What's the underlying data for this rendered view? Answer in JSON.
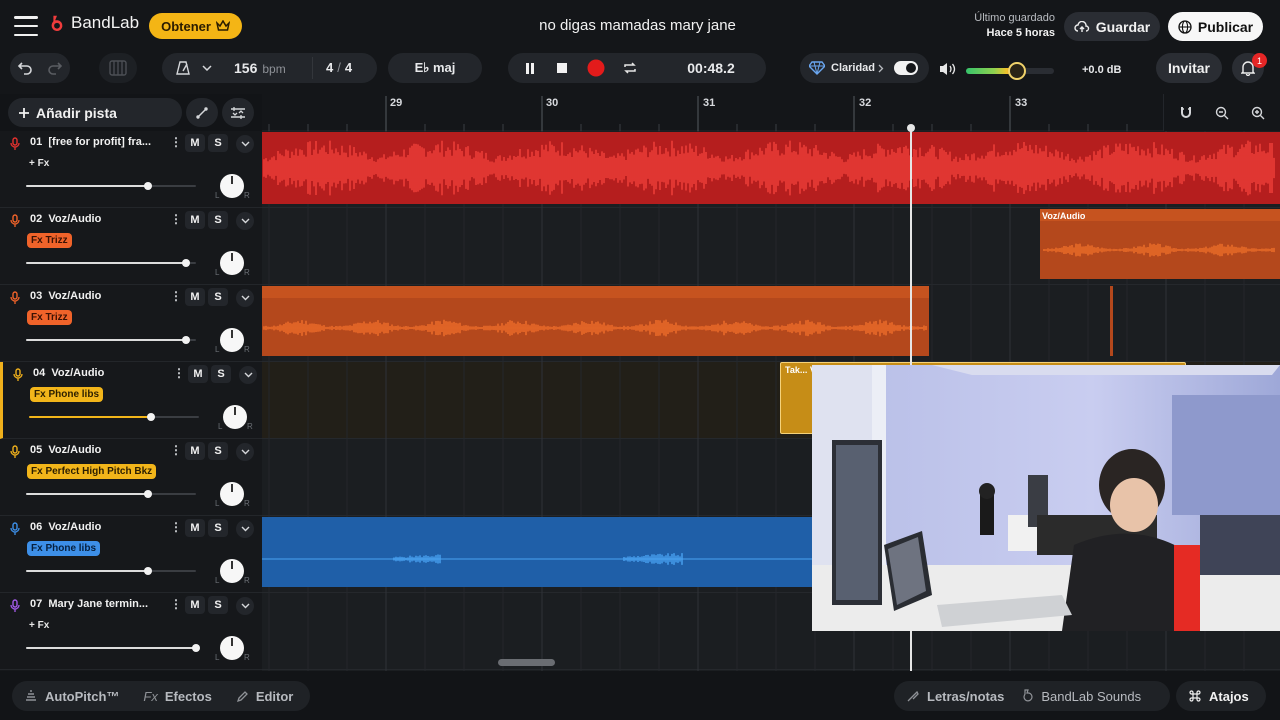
{
  "app": {
    "brand": "BandLab",
    "obtener_label": "Obtener",
    "project_title": "no digas mamadas mary jane",
    "saved_label": "Último guardado",
    "saved_time": "Hace 5 horas",
    "guardar_label": "Guardar",
    "publicar_label": "Publicar"
  },
  "transport": {
    "tempo": "156",
    "tempo_unit": "bpm",
    "time_sig_num": "4",
    "time_sig_sep": "/",
    "time_sig_den": "4",
    "key": "E♭ maj",
    "time": "00:48.2",
    "clarity_label": "Claridad",
    "clarity_on": true,
    "volume_db": "+0.0 dB",
    "master_volume": 0.58,
    "invitar_label": "Invitar",
    "notification_count": "1"
  },
  "toolbar": {
    "add_track_label": "Añadir pista"
  },
  "ruler": {
    "bars": [
      "29",
      "30",
      "31",
      "32",
      "33"
    ]
  },
  "tracks": [
    {
      "number": "01",
      "name": "[free for profit] fra...",
      "fx": "+ Fx",
      "fx_style": "plain",
      "color": "#e5312e",
      "volume": 0.72
    },
    {
      "number": "02",
      "name": "Voz/Audio",
      "fx": "Fx Trizz",
      "fx_style": "orange",
      "color": "#f0632a",
      "volume": 0.94
    },
    {
      "number": "03",
      "name": "Voz/Audio",
      "fx": "Fx Trizz",
      "fx_style": "orange",
      "color": "#f0632a",
      "volume": 0.94
    },
    {
      "number": "04",
      "name": "Voz/Audio",
      "fx": "Fx Phone libs",
      "fx_style": "yellow",
      "color": "#efb01c",
      "volume": 0.72
    },
    {
      "number": "05",
      "name": "Voz/Audio",
      "fx": "Fx Perfect High Pitch Bkz",
      "fx_style": "yellow",
      "color": "#efb01c",
      "volume": 0.72
    },
    {
      "number": "06",
      "name": "Voz/Audio",
      "fx": "Fx Phone libs",
      "fx_style": "blue",
      "color": "#3d8fe8",
      "volume": 0.72
    },
    {
      "number": "07",
      "name": "Mary Jane termin...",
      "fx": "+ Fx",
      "fx_style": "plain",
      "color": "#a35ae8",
      "volume": 1.0
    }
  ],
  "track_buttons": {
    "mute": "M",
    "solo": "S",
    "pan_left": "L",
    "pan_right": "R"
  },
  "clips": {
    "track02_label": "Voz/Audio",
    "track04_label": "Tak... Voz/Audio"
  },
  "bottom": {
    "autopitch": "AutoPitch™",
    "efectos": "Efectos",
    "editor": "Editor",
    "letras": "Letras/notas",
    "sounds": "BandLab Sounds",
    "atajos": "Atajos"
  }
}
